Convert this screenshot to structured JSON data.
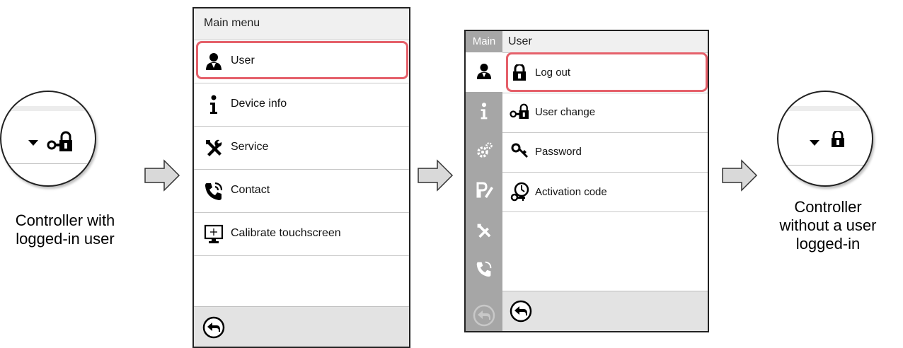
{
  "left_caption": {
    "line1": "Controller with",
    "line2": "logged-in user"
  },
  "right_caption": {
    "line1": "Controller",
    "line2": "without a user",
    "line3": "logged-in"
  },
  "screen1": {
    "title": "Main menu",
    "items": [
      {
        "label": "User",
        "icon": "user-icon",
        "highlighted": true
      },
      {
        "label": "Device info",
        "icon": "info-icon"
      },
      {
        "label": "Service",
        "icon": "tools-icon"
      },
      {
        "label": "Contact",
        "icon": "phone-icon"
      },
      {
        "label": "Calibrate touchscreen",
        "icon": "touchscreen-icon"
      }
    ]
  },
  "screen2": {
    "sidebar_label": "Main",
    "title": "User",
    "items": [
      {
        "label": "Log out",
        "icon": "lock-icon",
        "highlighted": true
      },
      {
        "label": "User change",
        "icon": "user-change-icon"
      },
      {
        "label": "Password",
        "icon": "key-icon"
      },
      {
        "label": "Activation code",
        "icon": "activation-code-icon"
      }
    ]
  },
  "colors": {
    "highlight": "#e5606a",
    "sidebar": "#a6a6a6",
    "footer": "#e3e3e3"
  }
}
